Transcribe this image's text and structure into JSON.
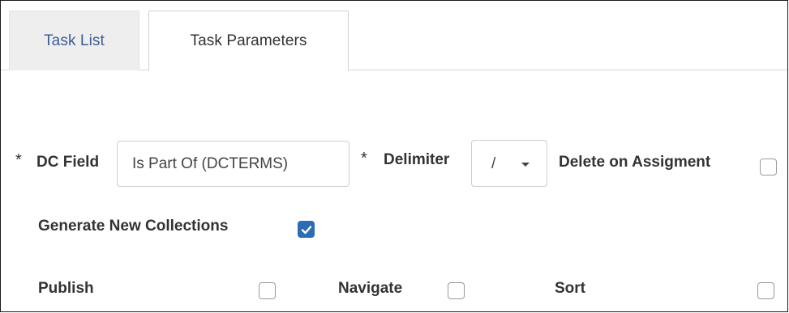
{
  "tabs": [
    {
      "label": "Task List",
      "active": false
    },
    {
      "label": "Task Parameters",
      "active": true
    }
  ],
  "form": {
    "required_marker": "*",
    "dc_field": {
      "label": "DC Field",
      "value": "Is Part Of (DCTERMS)"
    },
    "delimiter": {
      "label": "Delimiter",
      "value": "/"
    },
    "delete_on_assignment": {
      "label": "Delete on Assigment",
      "checked": false
    },
    "generate_new_collections": {
      "label": "Generate New Collections",
      "checked": true
    },
    "publish": {
      "label": "Publish",
      "checked": false
    },
    "navigate": {
      "label": "Navigate",
      "checked": false
    },
    "sort": {
      "label": "Sort",
      "checked": false
    }
  },
  "colors": {
    "accent": "#2c6cb5",
    "tab_inactive_text": "#3d5c95",
    "tab_inactive_bg": "#eeeeee"
  }
}
